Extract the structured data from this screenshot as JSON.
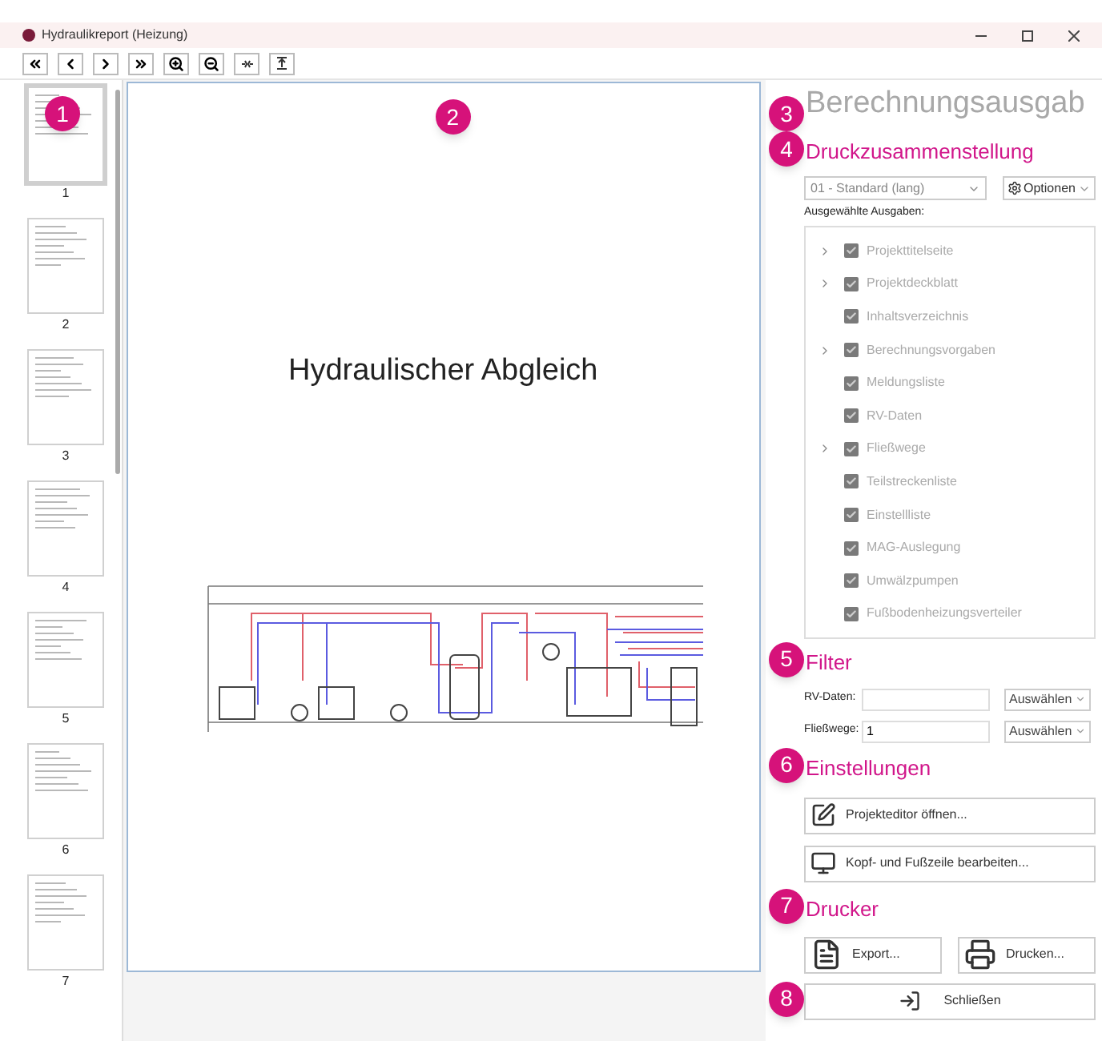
{
  "window": {
    "title": "Hydraulikreport (Heizung)"
  },
  "thumbnails": [
    {
      "page": "1",
      "selected": true
    },
    {
      "page": "2",
      "selected": false
    },
    {
      "page": "3",
      "selected": false
    },
    {
      "page": "4",
      "selected": false
    },
    {
      "page": "5",
      "selected": false
    },
    {
      "page": "6",
      "selected": false
    },
    {
      "page": "7",
      "selected": false
    }
  ],
  "preview": {
    "title": "Hydraulischer Abgleich"
  },
  "panel": {
    "title": "Berechnungsausgab",
    "sections": [
      {
        "heading": "Druckzusammenstellung"
      },
      {
        "heading": "Filter"
      },
      {
        "heading": "Einstellungen"
      },
      {
        "heading": "Drucker"
      }
    ],
    "preset": {
      "value": "01 - Standard (lang)"
    },
    "options_button": "Optionen",
    "outputs_label": "Ausgewählte Ausgaben:",
    "outputs": [
      {
        "label": "Projekttitelseite",
        "collapsible": true,
        "checked": true
      },
      {
        "label": "Projektdeckblatt",
        "collapsible": true,
        "checked": true
      },
      {
        "label": "Inhaltsverzeichnis",
        "collapsible": false,
        "checked": true
      },
      {
        "label": "Berechnungsvorgaben",
        "collapsible": true,
        "checked": true
      },
      {
        "label": "Meldungsliste",
        "collapsible": false,
        "checked": true
      },
      {
        "label": "RV-Daten",
        "collapsible": false,
        "checked": true
      },
      {
        "label": "Fließwege",
        "collapsible": true,
        "checked": true
      },
      {
        "label": "Teilstreckenliste",
        "collapsible": false,
        "checked": true
      },
      {
        "label": "Einstellliste",
        "collapsible": false,
        "checked": true
      },
      {
        "label": "MAG-Auslegung",
        "collapsible": false,
        "checked": true
      },
      {
        "label": "Umwälzpumpen",
        "collapsible": false,
        "checked": true
      },
      {
        "label": "Fußbodenheizungsverteiler",
        "collapsible": false,
        "checked": true
      }
    ],
    "filters": [
      {
        "label": "RV-Daten:",
        "select": "Auswählen"
      },
      {
        "label": "Fließwege:",
        "value": "1",
        "select": "Auswählen"
      }
    ],
    "settings_buttons": [
      {
        "label": "Projekteditor öffnen...",
        "kind": "edit"
      },
      {
        "label": "Kopf- und Fußzeile bearbeiten...",
        "kind": "header"
      }
    ],
    "printer_buttons": [
      {
        "label": "Export...",
        "kind": "pdf"
      },
      {
        "label": "Drucken...",
        "kind": "print"
      }
    ],
    "close_button": "Schließen"
  },
  "markers": [
    "1",
    "2",
    "3",
    "4",
    "5",
    "6",
    "7",
    "8"
  ]
}
